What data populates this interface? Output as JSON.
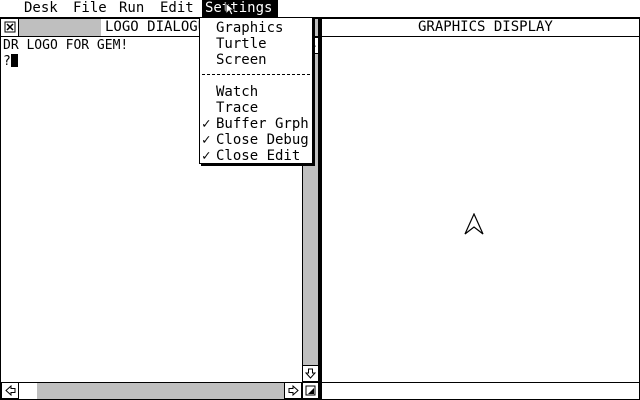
{
  "menubar": {
    "desk": "Desk",
    "file": "File",
    "run": "Run",
    "edit": "Edit",
    "settings": "Settings"
  },
  "settings_menu": {
    "items": [
      {
        "label": "Graphics",
        "checked": false
      },
      {
        "label": "Turtle",
        "checked": false
      },
      {
        "label": "Screen",
        "checked": false
      }
    ],
    "items2": [
      {
        "label": "Watch",
        "checked": false
      },
      {
        "label": "Trace",
        "checked": false
      },
      {
        "label": "Buffer Grph",
        "checked": true
      },
      {
        "label": "Close Debug",
        "checked": true
      },
      {
        "label": "Close Edit",
        "checked": true
      }
    ],
    "check_glyph": "✓"
  },
  "dialog_window": {
    "title": "LOGO DIALOGUE",
    "line1": "DR LOGO FOR GEM!",
    "prompt": "?"
  },
  "graphics_window": {
    "title": "GRAPHICS DISPLAY"
  },
  "icons": {
    "close": "close-box-icon",
    "arrow_up": "arrow-up-icon",
    "arrow_down": "arrow-down-icon",
    "arrow_left": "arrow-left-icon",
    "arrow_right": "arrow-right-icon",
    "size": "size-box-icon",
    "turtle": "turtle-cursor-icon",
    "pointer": "mouse-pointer-icon"
  }
}
